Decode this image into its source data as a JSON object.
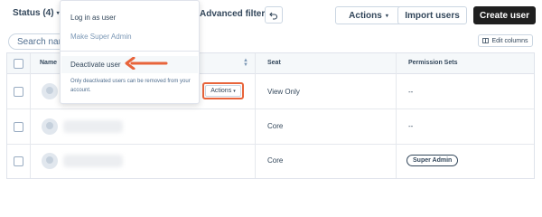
{
  "toolbar": {
    "status_filter": "Status (4)",
    "advanced_filters": "Advanced filters",
    "actions_label": "Actions",
    "import_users_label": "Import users",
    "create_user_label": "Create user"
  },
  "search": {
    "placeholder": "Search name"
  },
  "edit_columns_label": "Edit columns",
  "table": {
    "headers": {
      "name": "Name",
      "seat": "Seat",
      "permission_sets": "Permission Sets"
    },
    "rows": [
      {
        "seat": "View Only",
        "permission": "--"
      },
      {
        "seat": "Core",
        "permission": "--"
      },
      {
        "seat": "Core",
        "permission": "Super Admin"
      }
    ],
    "row_actions_label": "Actions"
  },
  "dropdown": {
    "items": {
      "log_in_as_user": "Log in as user",
      "make_super_admin": "Make Super Admin",
      "deactivate_user": "Deactivate user"
    },
    "help_text": "Only deactivated users can be removed from your account."
  },
  "colors": {
    "highlight": "#e8643b",
    "primary_dark": "#1f1f1f",
    "text": "#33475b"
  }
}
